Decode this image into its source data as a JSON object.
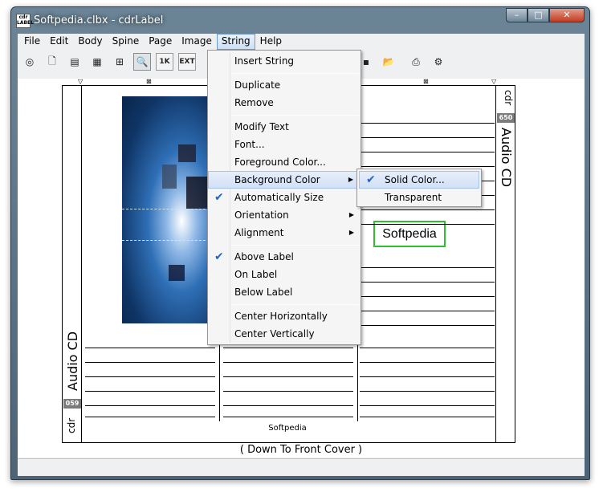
{
  "window": {
    "title": "Softpedia.clbx - cdrLabel",
    "app_icon": "cdr LABEL",
    "min": "–",
    "max": "□",
    "close": "✕"
  },
  "menubar": [
    "File",
    "Edit",
    "Body",
    "Spine",
    "Page",
    "Image",
    "String",
    "Help"
  ],
  "toolbar": {
    "k1": "1K",
    "ext": "EXT"
  },
  "spine": {
    "left_title": "Audio CD",
    "left_badge": "059",
    "left_sub": "cdr",
    "right_title": "Audio CD",
    "right_badge": "650",
    "right_sub": "cdr"
  },
  "label": {
    "green_text": "Softpedia",
    "footer": "Softpedia"
  },
  "caption": "( Down To Front Cover )",
  "string_menu": {
    "insert_string": "Insert String",
    "duplicate": "Duplicate",
    "remove": "Remove",
    "modify_text": "Modify Text",
    "font": "Font...",
    "foreground_color": "Foreground Color...",
    "background_color": "Background Color",
    "automatically_size": "Automatically Size",
    "orientation": "Orientation",
    "alignment": "Alignment",
    "above_label": "Above Label",
    "on_label": "On Label",
    "below_label": "Below Label",
    "center_horizontally": "Center Horizontally",
    "center_vertically": "Center Vertically"
  },
  "background_submenu": {
    "solid_color": "Solid Color...",
    "transparent": "Transparent"
  },
  "colors": {
    "accent_green": "#2fc02f",
    "menu_highlight": "#d1e0f7",
    "check_blue": "#2563c9"
  }
}
